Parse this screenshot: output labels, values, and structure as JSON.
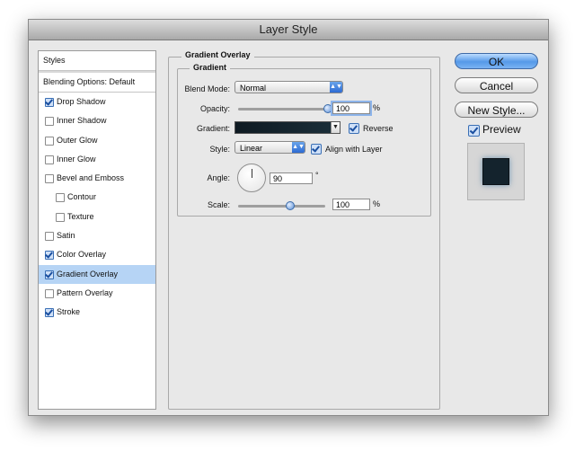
{
  "window": {
    "title": "Layer Style"
  },
  "styles_panel": {
    "header": "Styles",
    "blending": "Blending Options: Default",
    "items": [
      {
        "label": "Drop Shadow",
        "checked": true
      },
      {
        "label": "Inner Shadow",
        "checked": false
      },
      {
        "label": "Outer Glow",
        "checked": false
      },
      {
        "label": "Inner Glow",
        "checked": false
      },
      {
        "label": "Bevel and Emboss",
        "checked": false
      },
      {
        "label": "Contour",
        "checked": false
      },
      {
        "label": "Texture",
        "checked": false
      },
      {
        "label": "Satin",
        "checked": false
      },
      {
        "label": "Color Overlay",
        "checked": true
      },
      {
        "label": "Gradient Overlay",
        "checked": true,
        "selected": true
      },
      {
        "label": "Pattern Overlay",
        "checked": false
      },
      {
        "label": "Stroke",
        "checked": true
      }
    ]
  },
  "gradient_overlay": {
    "section_title": "Gradient Overlay",
    "group_title": "Gradient",
    "blend_mode_label": "Blend Mode:",
    "blend_mode_value": "Normal",
    "opacity_label": "Opacity:",
    "opacity_value": "100",
    "opacity_unit": "%",
    "opacity_level": 1.0,
    "gradient_label": "Gradient:",
    "gradient_colors": [
      "#0e1a22",
      "#1b2f3a"
    ],
    "reverse_label": "Reverse",
    "reverse_checked": true,
    "style_label": "Style:",
    "style_value": "Linear",
    "align_label": "Align with Layer",
    "align_checked": true,
    "angle_label": "Angle:",
    "angle_value": "90",
    "angle_unit": "°",
    "scale_label": "Scale:",
    "scale_value": "100",
    "scale_unit": "%",
    "scale_level": 0.6
  },
  "buttons": {
    "ok": "OK",
    "cancel": "Cancel",
    "new_style": "New Style..."
  },
  "preview": {
    "label": "Preview",
    "checked": true
  },
  "colors": {
    "accent": "#5599e8",
    "selection": "#b6d4f5",
    "swatch": "#14232d"
  }
}
